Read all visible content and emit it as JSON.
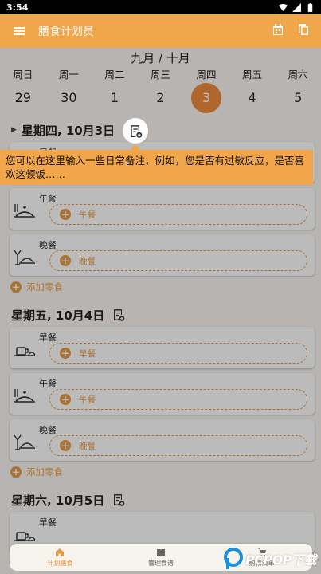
{
  "status_bar": {
    "time": "3:54"
  },
  "app_bar": {
    "title": "膳食计划员"
  },
  "calendar": {
    "month_label": "九月 / 十月",
    "days": [
      {
        "name": "周日",
        "num": "29"
      },
      {
        "name": "周一",
        "num": "30"
      },
      {
        "name": "周二",
        "num": "1"
      },
      {
        "name": "周三",
        "num": "2"
      },
      {
        "name": "周四",
        "num": "3",
        "selected": true
      },
      {
        "name": "周五",
        "num": "4"
      },
      {
        "name": "周六",
        "num": "5"
      }
    ]
  },
  "days": [
    {
      "title": "星期四, 10月3日",
      "meals": [
        {
          "label": "早餐",
          "add": "早餐"
        },
        {
          "label": "午餐",
          "add": "午餐"
        },
        {
          "label": "晚餐",
          "add": "晚餐"
        }
      ],
      "snack": "添加零食"
    },
    {
      "title": "星期五, 10月4日",
      "meals": [
        {
          "label": "早餐",
          "add": "早餐"
        },
        {
          "label": "午餐",
          "add": "午餐"
        },
        {
          "label": "晚餐",
          "add": "晚餐"
        }
      ],
      "snack": "添加零食"
    },
    {
      "title": "星期六, 10月5日",
      "meals": [
        {
          "label": "早餐",
          "add": "早餐"
        }
      ]
    }
  ],
  "tooltip": {
    "text": "您可以在这里输入一些日常备注，例如，您是否有过敏反应，是否喜欢这顿饭……"
  },
  "bottom_nav": [
    {
      "label": "计划膳食",
      "active": true
    },
    {
      "label": "管理食谱"
    },
    {
      "label": "购物清单"
    }
  ],
  "watermark": {
    "text": "PCPOP下载"
  },
  "colors": {
    "accent": "#f0a64b",
    "selected_day": "#e8893c",
    "add_slot": "#e39a45"
  }
}
